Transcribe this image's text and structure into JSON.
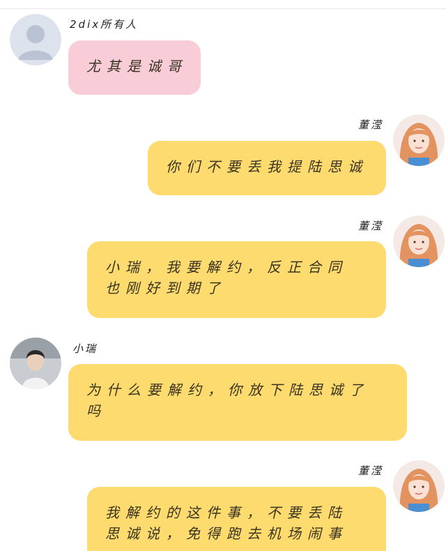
{
  "theme": {
    "pink_bubble": "#f9cdd8",
    "yellow_bubble": "#fddb6f",
    "background": "#ffffff"
  },
  "messages": [
    {
      "sender": "2dix所有人",
      "side": "left",
      "avatar_icon": "default-user-avatar-icon",
      "bubble_color": "#f9cdd8",
      "lines": [
        "尤其是诚哥"
      ]
    },
    {
      "sender": "董滢",
      "side": "right",
      "avatar_icon": "girl-avatar-photo",
      "bubble_color": "#fddb6f",
      "lines": [
        "你们不要丢我提陆思诚"
      ]
    },
    {
      "sender": "董滢",
      "side": "right",
      "avatar_icon": "girl-avatar-photo",
      "bubble_color": "#fddb6f",
      "lines": [
        "小瑞，我要解约，反正合同",
        "也刚好到期了"
      ]
    },
    {
      "sender": "小瑞",
      "side": "left",
      "avatar_icon": "boy-avatar-photo",
      "bubble_color": "#fddb6f",
      "lines": [
        "为什么要解约，你放下陆思诚了",
        "吗"
      ]
    },
    {
      "sender": "董滢",
      "side": "right",
      "avatar_icon": "girl-avatar-photo",
      "bubble_color": "#fddb6f",
      "lines": [
        "我解约的这件事，不要丢陆",
        "思诚说，免得跑去机场闹事"
      ]
    }
  ]
}
